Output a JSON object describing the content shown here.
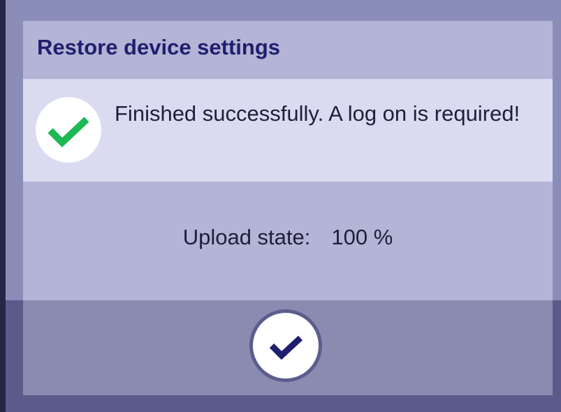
{
  "dialog": {
    "title": "Restore device settings",
    "message": "Finished successfully. A log on is required!",
    "status_icon": "check-icon",
    "status_color": "#1db954",
    "upload": {
      "label": "Upload state:",
      "value": "100 %"
    },
    "confirm_icon": "check-icon",
    "confirm_color": "#1f1f6e"
  }
}
